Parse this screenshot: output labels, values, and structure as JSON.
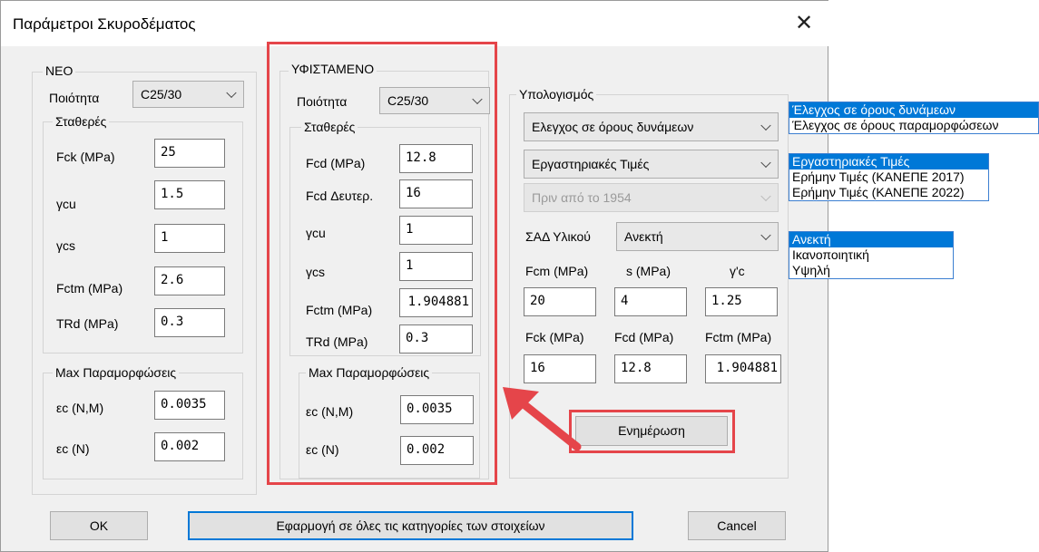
{
  "window": {
    "title": "Παράμετροι Σκυροδέματος",
    "close_glyph": "✕"
  },
  "neo": {
    "label": "ΝΕΟ",
    "quality_label": "Ποιότητα",
    "quality_value": "C25/30",
    "constants_label": "Σταθερές",
    "fields": [
      {
        "label": "Fck (MPa)",
        "value": "25"
      },
      {
        "label": "γcu",
        "value": "1.5"
      },
      {
        "label": "γcs",
        "value": "1"
      },
      {
        "label": "Fctm (MPa)",
        "value": "2.6"
      },
      {
        "label": "TRd (MPa)",
        "value": "0.3"
      }
    ],
    "strain_label": "Max Παραμορφώσεις",
    "strains": [
      {
        "label": "εc (N,M)",
        "value": "0.0035"
      },
      {
        "label": "εc (N)",
        "value": "0.002"
      }
    ]
  },
  "existing": {
    "label": "ΥΦΙΣΤΑΜΕΝΟ",
    "quality_label": "Ποιότητα",
    "quality_value": "C25/30",
    "constants_label": "Σταθερές",
    "fields": [
      {
        "label": "Fcd (MPa)",
        "value": "12.8"
      },
      {
        "label": "Fcd Δευτερ.",
        "value": "16"
      },
      {
        "label": "γcu",
        "value": "1"
      },
      {
        "label": "γcs",
        "value": "1"
      },
      {
        "label": "Fctm (MPa)",
        "value": "1.904881"
      },
      {
        "label": "TRd (MPa)",
        "value": "0.3"
      }
    ],
    "strain_label": "Max Παραμορφώσεις",
    "strains": [
      {
        "label": "εc (N,M)",
        "value": "0.0035"
      },
      {
        "label": "εc (N)",
        "value": "0.002"
      }
    ]
  },
  "calc": {
    "label": "Υπολογισμός",
    "method_value": "Ελεγχος σε όρους δυνάμεων",
    "values_value": "Εργαστηριακές Τιμές",
    "period_value": "Πριν από το 1954",
    "sad_label": "ΣΑΔ Υλικού",
    "sad_value": "Ανεκτή",
    "headers1": [
      "Fcm (MPa)",
      "s (MPa)",
      "γ'c"
    ],
    "values1": [
      "20",
      "4",
      "1.25"
    ],
    "headers2": [
      "Fck (MPa)",
      "Fcd (MPa)",
      "Fctm (MPa)"
    ],
    "values2": [
      "16",
      "12.8",
      "1.904881"
    ],
    "update_label": "Ενημέρωση"
  },
  "lists": {
    "method": [
      "Έλεγχος σε όρους δυνάμεων",
      "Έλεγχος σε όρους παραμορφώσεων"
    ],
    "values": [
      "Εργαστηριακές Τιμές",
      "Ερήμην Τιμές (ΚΑΝΕΠΕ 2017)",
      "Ερήμην Τιμές (ΚΑΝΕΠΕ 2022)"
    ],
    "sad": [
      "Ανεκτή",
      "Ικανοποιητική",
      "Υψηλή"
    ]
  },
  "buttons": {
    "ok": "OK",
    "apply_all": "Εφαρμογή σε όλες τις κατηγορίες των στοιχείων",
    "cancel": "Cancel"
  },
  "colors": {
    "highlight": "#e5454a",
    "selection": "#0078d7",
    "list_border": "#3c7fd1"
  }
}
